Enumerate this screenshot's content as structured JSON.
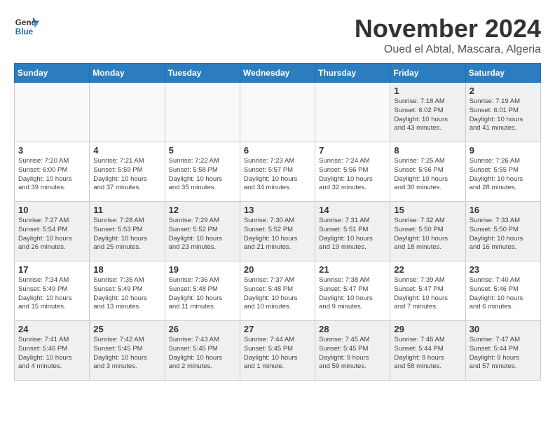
{
  "header": {
    "logo_line1": "General",
    "logo_line2": "Blue",
    "month_title": "November 2024",
    "subtitle": "Oued el Abtal, Mascara, Algeria"
  },
  "weekdays": [
    "Sunday",
    "Monday",
    "Tuesday",
    "Wednesday",
    "Thursday",
    "Friday",
    "Saturday"
  ],
  "weeks": [
    [
      {
        "day": "",
        "info": "",
        "empty": true
      },
      {
        "day": "",
        "info": "",
        "empty": true
      },
      {
        "day": "",
        "info": "",
        "empty": true
      },
      {
        "day": "",
        "info": "",
        "empty": true
      },
      {
        "day": "",
        "info": "",
        "empty": true
      },
      {
        "day": "1",
        "info": "Sunrise: 7:18 AM\nSunset: 6:02 PM\nDaylight: 10 hours\nand 43 minutes."
      },
      {
        "day": "2",
        "info": "Sunrise: 7:19 AM\nSunset: 6:01 PM\nDaylight: 10 hours\nand 41 minutes."
      }
    ],
    [
      {
        "day": "3",
        "info": "Sunrise: 7:20 AM\nSunset: 6:00 PM\nDaylight: 10 hours\nand 39 minutes."
      },
      {
        "day": "4",
        "info": "Sunrise: 7:21 AM\nSunset: 5:59 PM\nDaylight: 10 hours\nand 37 minutes."
      },
      {
        "day": "5",
        "info": "Sunrise: 7:22 AM\nSunset: 5:58 PM\nDaylight: 10 hours\nand 35 minutes."
      },
      {
        "day": "6",
        "info": "Sunrise: 7:23 AM\nSunset: 5:57 PM\nDaylight: 10 hours\nand 34 minutes."
      },
      {
        "day": "7",
        "info": "Sunrise: 7:24 AM\nSunset: 5:56 PM\nDaylight: 10 hours\nand 32 minutes."
      },
      {
        "day": "8",
        "info": "Sunrise: 7:25 AM\nSunset: 5:56 PM\nDaylight: 10 hours\nand 30 minutes."
      },
      {
        "day": "9",
        "info": "Sunrise: 7:26 AM\nSunset: 5:55 PM\nDaylight: 10 hours\nand 28 minutes."
      }
    ],
    [
      {
        "day": "10",
        "info": "Sunrise: 7:27 AM\nSunset: 5:54 PM\nDaylight: 10 hours\nand 26 minutes."
      },
      {
        "day": "11",
        "info": "Sunrise: 7:28 AM\nSunset: 5:53 PM\nDaylight: 10 hours\nand 25 minutes."
      },
      {
        "day": "12",
        "info": "Sunrise: 7:29 AM\nSunset: 5:52 PM\nDaylight: 10 hours\nand 23 minutes."
      },
      {
        "day": "13",
        "info": "Sunrise: 7:30 AM\nSunset: 5:52 PM\nDaylight: 10 hours\nand 21 minutes."
      },
      {
        "day": "14",
        "info": "Sunrise: 7:31 AM\nSunset: 5:51 PM\nDaylight: 10 hours\nand 19 minutes."
      },
      {
        "day": "15",
        "info": "Sunrise: 7:32 AM\nSunset: 5:50 PM\nDaylight: 10 hours\nand 18 minutes."
      },
      {
        "day": "16",
        "info": "Sunrise: 7:33 AM\nSunset: 5:50 PM\nDaylight: 10 hours\nand 16 minutes."
      }
    ],
    [
      {
        "day": "17",
        "info": "Sunrise: 7:34 AM\nSunset: 5:49 PM\nDaylight: 10 hours\nand 15 minutes."
      },
      {
        "day": "18",
        "info": "Sunrise: 7:35 AM\nSunset: 5:49 PM\nDaylight: 10 hours\nand 13 minutes."
      },
      {
        "day": "19",
        "info": "Sunrise: 7:36 AM\nSunset: 5:48 PM\nDaylight: 10 hours\nand 11 minutes."
      },
      {
        "day": "20",
        "info": "Sunrise: 7:37 AM\nSunset: 5:48 PM\nDaylight: 10 hours\nand 10 minutes."
      },
      {
        "day": "21",
        "info": "Sunrise: 7:38 AM\nSunset: 5:47 PM\nDaylight: 10 hours\nand 9 minutes."
      },
      {
        "day": "22",
        "info": "Sunrise: 7:39 AM\nSunset: 5:47 PM\nDaylight: 10 hours\nand 7 minutes."
      },
      {
        "day": "23",
        "info": "Sunrise: 7:40 AM\nSunset: 5:46 PM\nDaylight: 10 hours\nand 6 minutes."
      }
    ],
    [
      {
        "day": "24",
        "info": "Sunrise: 7:41 AM\nSunset: 5:46 PM\nDaylight: 10 hours\nand 4 minutes."
      },
      {
        "day": "25",
        "info": "Sunrise: 7:42 AM\nSunset: 5:45 PM\nDaylight: 10 hours\nand 3 minutes."
      },
      {
        "day": "26",
        "info": "Sunrise: 7:43 AM\nSunset: 5:45 PM\nDaylight: 10 hours\nand 2 minutes."
      },
      {
        "day": "27",
        "info": "Sunrise: 7:44 AM\nSunset: 5:45 PM\nDaylight: 10 hours\nand 1 minute."
      },
      {
        "day": "28",
        "info": "Sunrise: 7:45 AM\nSunset: 5:45 PM\nDaylight: 9 hours\nand 59 minutes."
      },
      {
        "day": "29",
        "info": "Sunrise: 7:46 AM\nSunset: 5:44 PM\nDaylight: 9 hours\nand 58 minutes."
      },
      {
        "day": "30",
        "info": "Sunrise: 7:47 AM\nSunset: 5:44 PM\nDaylight: 9 hours\nand 57 minutes."
      }
    ]
  ]
}
